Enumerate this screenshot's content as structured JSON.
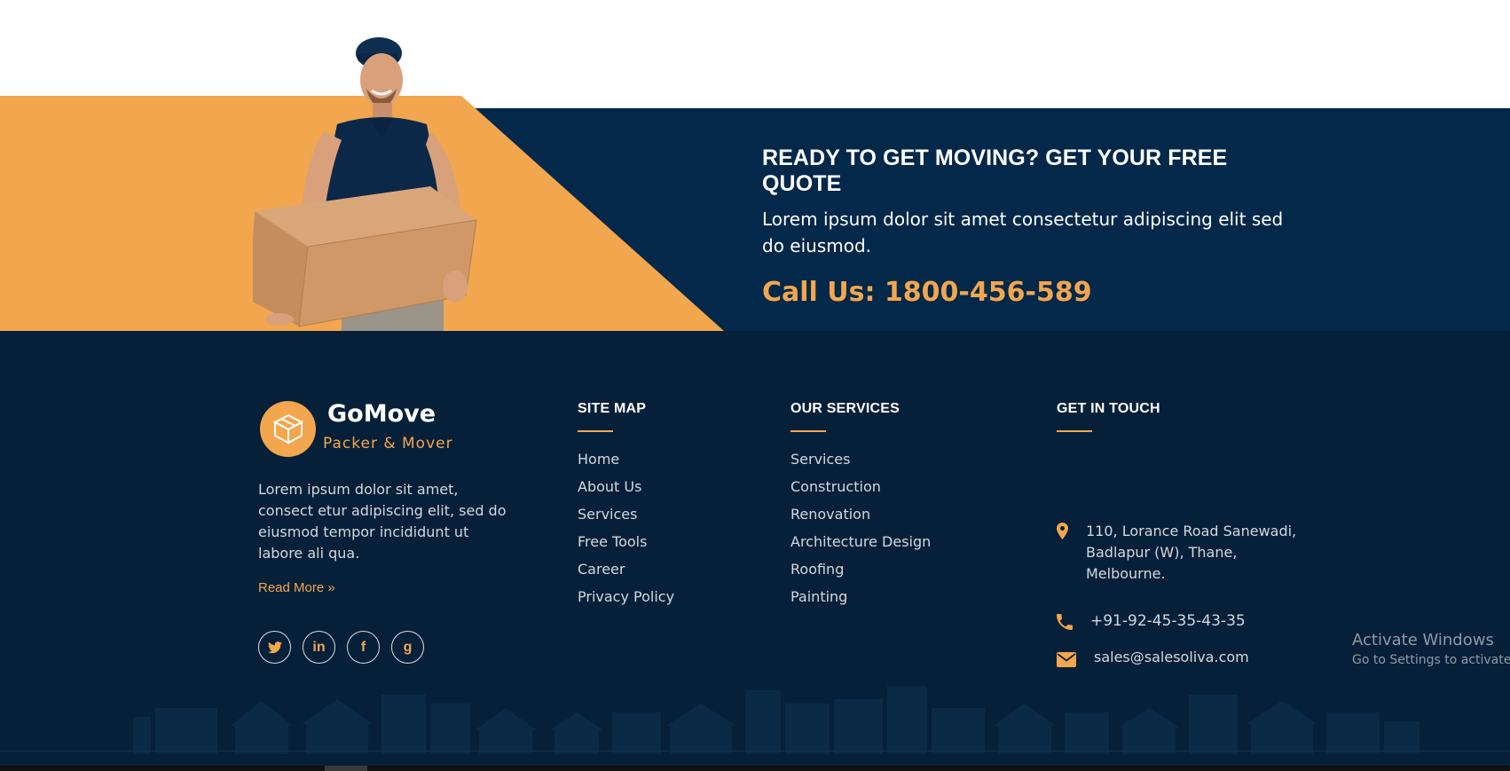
{
  "cta": {
    "title": "READY TO GET MOVING? GET YOUR FREE QUOTE",
    "description": "Lorem ipsum dolor sit amet consectetur adipiscing elit sed do eiusmod.",
    "call": "Call Us: 1800-456-589"
  },
  "brand": {
    "name": "GoMove",
    "tagline": "Packer & Mover",
    "about": "Lorem ipsum dolor sit amet, consect etur adipiscing elit, sed do eiusmod tempor incididunt ut labore ali qua.",
    "read_more": "Read More »"
  },
  "socials": [
    {
      "icon": "twitter-icon",
      "glyph": "🐦"
    },
    {
      "icon": "linkedin-icon",
      "glyph": "in"
    },
    {
      "icon": "facebook-icon",
      "glyph": "f"
    },
    {
      "icon": "google-icon",
      "glyph": "g"
    }
  ],
  "sitemap": {
    "title": "SITE MAP",
    "items": [
      "Home",
      "About Us",
      "Services",
      "Free Tools",
      "Career",
      "Privacy Policy"
    ]
  },
  "services": {
    "title": "OUR SERVICES",
    "items": [
      "Services",
      "Construction",
      "Renovation",
      "Architecture Design",
      "Roofing",
      "Painting"
    ]
  },
  "contact": {
    "title": "GET IN TOUCH",
    "address": "110, Lorance Road Sanewadi, Badlapur (W), Thane, Melbourne.",
    "phone": "+91-92-45-35-43-35",
    "email": "sales@salesoliva.com"
  },
  "watermark": {
    "line1": "Activate Windows",
    "line2": "Go to Settings to activate W"
  },
  "colors": {
    "accent": "#f2a64e",
    "navy": "#03284a",
    "footer_bg": "#062039"
  }
}
